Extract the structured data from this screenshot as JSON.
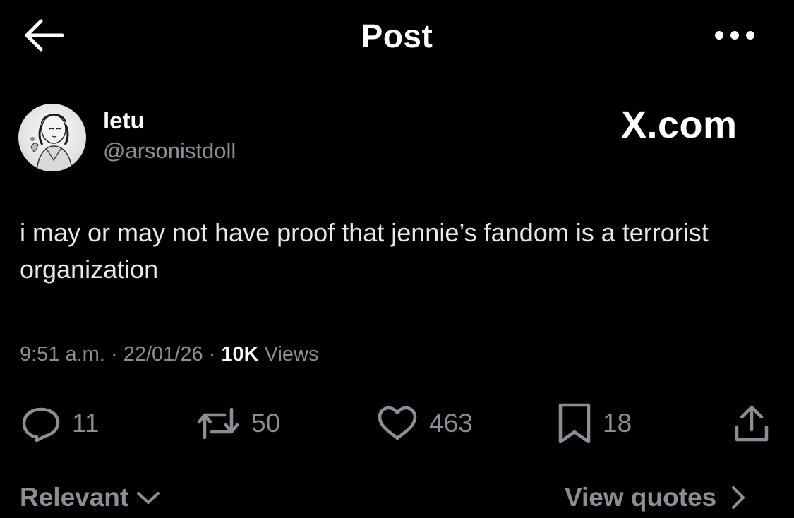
{
  "header": {
    "title": "Post",
    "back_icon": "arrow-left-icon",
    "more_icon": "more-horizontal-icon"
  },
  "post": {
    "author_name": "letu",
    "author_handle": "@arsonistdoll",
    "brand": "X.com",
    "text": "i may or may not have proof that jennie’s fandom is a terrorist organization",
    "time": "9:51 a.m.",
    "date": "22/01/26",
    "views_count": "10K",
    "views_label": "Views",
    "separator": "·"
  },
  "actions": {
    "replies": "11",
    "reposts": "50",
    "likes": "463",
    "bookmarks": "18"
  },
  "footer": {
    "sort_label": "Relevant",
    "quotes_label": "View quotes"
  },
  "colors": {
    "background": "#000000",
    "text_primary": "#ffffff",
    "text_secondary": "#8b8f94"
  }
}
